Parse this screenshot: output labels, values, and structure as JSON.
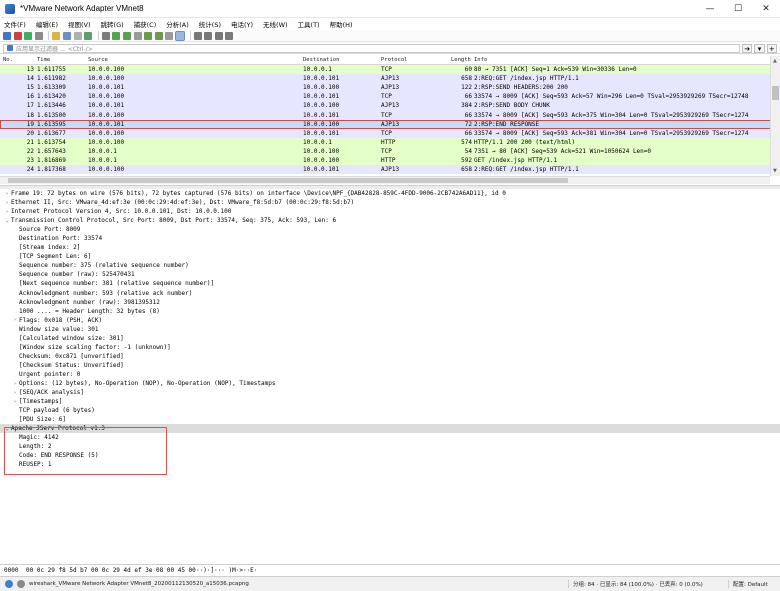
{
  "window": {
    "title": "*VMware Network Adapter VMnet8"
  },
  "window_controls": {
    "minimize": "—",
    "maximize": "☐",
    "close": "✕"
  },
  "menu": [
    "文件(F)",
    "编辑(E)",
    "视图(V)",
    "跳转(G)",
    "捕获(C)",
    "分析(A)",
    "统计(S)",
    "电话(Y)",
    "无线(W)",
    "工具(T)",
    "帮助(H)"
  ],
  "filter": {
    "placeholder": "应用显示过滤器 … <Ctrl-/>",
    "arrow_btn": "➔",
    "dropdown_btn": "▾",
    "add_btn": "+"
  },
  "columns": {
    "no": "No.",
    "time": "Time",
    "source": "Source",
    "destination": "Destination",
    "protocol": "Protocol",
    "length": "Length",
    "info": "Info"
  },
  "packets": [
    {
      "no": "13",
      "time": "1.611755",
      "src": "10.0.0.100",
      "dst": "10.0.0.1",
      "proto": "TCP",
      "len": "60",
      "info": "80 → 7351 [ACK] Seq=1 Ack=539 Win=30336 Len=0",
      "style": "green"
    },
    {
      "no": "14",
      "time": "1.611982",
      "src": "10.0.0.100",
      "dst": "10.0.0.101",
      "proto": "AJP13",
      "len": "658",
      "info": "2:REQ:GET /index.jsp HTTP/1.1",
      "style": "tcp"
    },
    {
      "no": "15",
      "time": "1.613309",
      "src": "10.0.0.101",
      "dst": "10.0.0.100",
      "proto": "AJP13",
      "len": "122",
      "info": "2:RSP:SEND HEADERS:200 200",
      "style": "tcp"
    },
    {
      "no": "16",
      "time": "1.613420",
      "src": "10.0.0.100",
      "dst": "10.0.0.101",
      "proto": "TCP",
      "len": "66",
      "info": "33574 → 8009 [ACK] Seq=593 Ack=57 Win=296 Len=0 TSval=2953929269 TSecr=12748",
      "style": "tcp"
    },
    {
      "no": "17",
      "time": "1.613446",
      "src": "10.0.0.101",
      "dst": "10.0.0.100",
      "proto": "AJP13",
      "len": "384",
      "info": "2:RSP:SEND BODY CHUNK",
      "style": "tcp"
    },
    {
      "no": "18",
      "time": "1.613500",
      "src": "10.0.0.100",
      "dst": "10.0.0.101",
      "proto": "TCP",
      "len": "66",
      "info": "33574 → 8009 [ACK] Seq=593 Ack=375 Win=304 Len=0 TSval=2953929269 TSecr=1274",
      "style": "tcp"
    },
    {
      "no": "19",
      "time": "1.613595",
      "src": "10.0.0.101",
      "dst": "10.0.0.100",
      "proto": "AJP13",
      "len": "72",
      "info": "2:RSP:END RESPONSE",
      "style": "selected"
    },
    {
      "no": "20",
      "time": "1.613677",
      "src": "10.0.0.100",
      "dst": "10.0.0.101",
      "proto": "TCP",
      "len": "66",
      "info": "33574 → 8009 [ACK] Seq=593 Ack=381 Win=304 Len=0 TSval=2953929269 TSecr=1274",
      "style": "tcp"
    },
    {
      "no": "21",
      "time": "1.613754",
      "src": "10.0.0.100",
      "dst": "10.0.0.1",
      "proto": "HTTP",
      "len": "574",
      "info": "HTTP/1.1 200 200  (text/html)",
      "style": "green"
    },
    {
      "no": "22",
      "time": "1.657643",
      "src": "10.0.0.1",
      "dst": "10.0.0.100",
      "proto": "TCP",
      "len": "54",
      "info": "7351 → 80 [ACK] Seq=539 Ack=521 Win=1050624 Len=0",
      "style": "green"
    },
    {
      "no": "23",
      "time": "1.816869",
      "src": "10.0.0.1",
      "dst": "10.0.0.100",
      "proto": "HTTP",
      "len": "592",
      "info": "GET /index.jsp HTTP/1.1",
      "style": "green"
    },
    {
      "no": "24",
      "time": "1.817368",
      "src": "10.0.0.100",
      "dst": "10.0.0.101",
      "proto": "AJP13",
      "len": "658",
      "info": "2:REQ:GET /index.jsp HTTP/1.1",
      "style": "tcp"
    }
  ],
  "details": [
    {
      "arrow": "›",
      "indent": 0,
      "text": "Frame 19: 72 bytes on wire (576 bits), 72 bytes captured (576 bits) on interface \\Device\\NPF_{DAB42828-859C-4FDD-9006-2CB742A6AD11}, id 0"
    },
    {
      "arrow": "›",
      "indent": 0,
      "text": "Ethernet II, Src: VMware_4d:ef:3e (00:0c:29:4d:ef:3e), Dst: VMware_f8:5d:b7 (00:0c:29:f8:5d:b7)"
    },
    {
      "arrow": "›",
      "indent": 0,
      "text": "Internet Protocol Version 4, Src: 10.0.0.101, Dst: 10.0.0.100"
    },
    {
      "arrow": "⌄",
      "indent": 0,
      "text": "Transmission Control Protocol, Src Port: 8009, Dst Port: 33574, Seq: 375, Ack: 593, Len: 6"
    },
    {
      "arrow": "",
      "indent": 1,
      "text": "Source Port: 8009"
    },
    {
      "arrow": "",
      "indent": 1,
      "text": "Destination Port: 33574"
    },
    {
      "arrow": "",
      "indent": 1,
      "text": "[Stream index: 2]"
    },
    {
      "arrow": "",
      "indent": 1,
      "text": "[TCP Segment Len: 6]"
    },
    {
      "arrow": "",
      "indent": 1,
      "text": "Sequence number: 375    (relative sequence number)"
    },
    {
      "arrow": "",
      "indent": 1,
      "text": "Sequence number (raw): 525470431"
    },
    {
      "arrow": "",
      "indent": 1,
      "text": "[Next sequence number: 381    (relative sequence number)]"
    },
    {
      "arrow": "",
      "indent": 1,
      "text": "Acknowledgment number: 593    (relative ack number)"
    },
    {
      "arrow": "",
      "indent": 1,
      "text": "Acknowledgment number (raw): 3981395312"
    },
    {
      "arrow": "",
      "indent": 1,
      "text": "1000 .... = Header Length: 32 bytes (8)"
    },
    {
      "arrow": "›",
      "indent": 1,
      "text": "Flags: 0x018 (PSH, ACK)"
    },
    {
      "arrow": "",
      "indent": 1,
      "text": "Window size value: 301"
    },
    {
      "arrow": "",
      "indent": 1,
      "text": "[Calculated window size: 301]"
    },
    {
      "arrow": "",
      "indent": 1,
      "text": "[Window size scaling factor: -1 (unknown)]"
    },
    {
      "arrow": "",
      "indent": 1,
      "text": "Checksum: 0xc871 [unverified]"
    },
    {
      "arrow": "",
      "indent": 1,
      "text": "[Checksum Status: Unverified]"
    },
    {
      "arrow": "",
      "indent": 1,
      "text": "Urgent pointer: 0"
    },
    {
      "arrow": "›",
      "indent": 1,
      "text": "Options: (12 bytes), No-Operation (NOP), No-Operation (NOP), Timestamps"
    },
    {
      "arrow": "›",
      "indent": 1,
      "text": "[SEQ/ACK analysis]"
    },
    {
      "arrow": "›",
      "indent": 1,
      "text": "[Timestamps]"
    },
    {
      "arrow": "",
      "indent": 1,
      "text": "TCP payload (6 bytes)"
    },
    {
      "arrow": "",
      "indent": 1,
      "text": "[PDU Size: 6]"
    },
    {
      "arrow": "⌄",
      "indent": 0,
      "text": "Apache JServ Protocol v1.3",
      "hl": true
    },
    {
      "arrow": "",
      "indent": 1,
      "text": "Magic: 4142"
    },
    {
      "arrow": "",
      "indent": 1,
      "text": "Length: 2"
    },
    {
      "arrow": "",
      "indent": 1,
      "text": "Code: END RESPONSE (5)"
    },
    {
      "arrow": "",
      "indent": 1,
      "text": "REUSEP: 1"
    }
  ],
  "bytes": {
    "offset": "0000",
    "hex": "00 0c 29 f8 5d b7 00 0c  29 4d ef 3e 08 00 45 00",
    "ascii": "··)·]··· )M·>··E·"
  },
  "status": {
    "file": "wireshark_VMware Network Adapter VMnet8_20200112130520_a15036.pcapng",
    "stats": "分组: 84 · 已显示: 84 (100.0%) · 已丢弃: 0 (0.0%)",
    "profile": "配置: Default"
  }
}
